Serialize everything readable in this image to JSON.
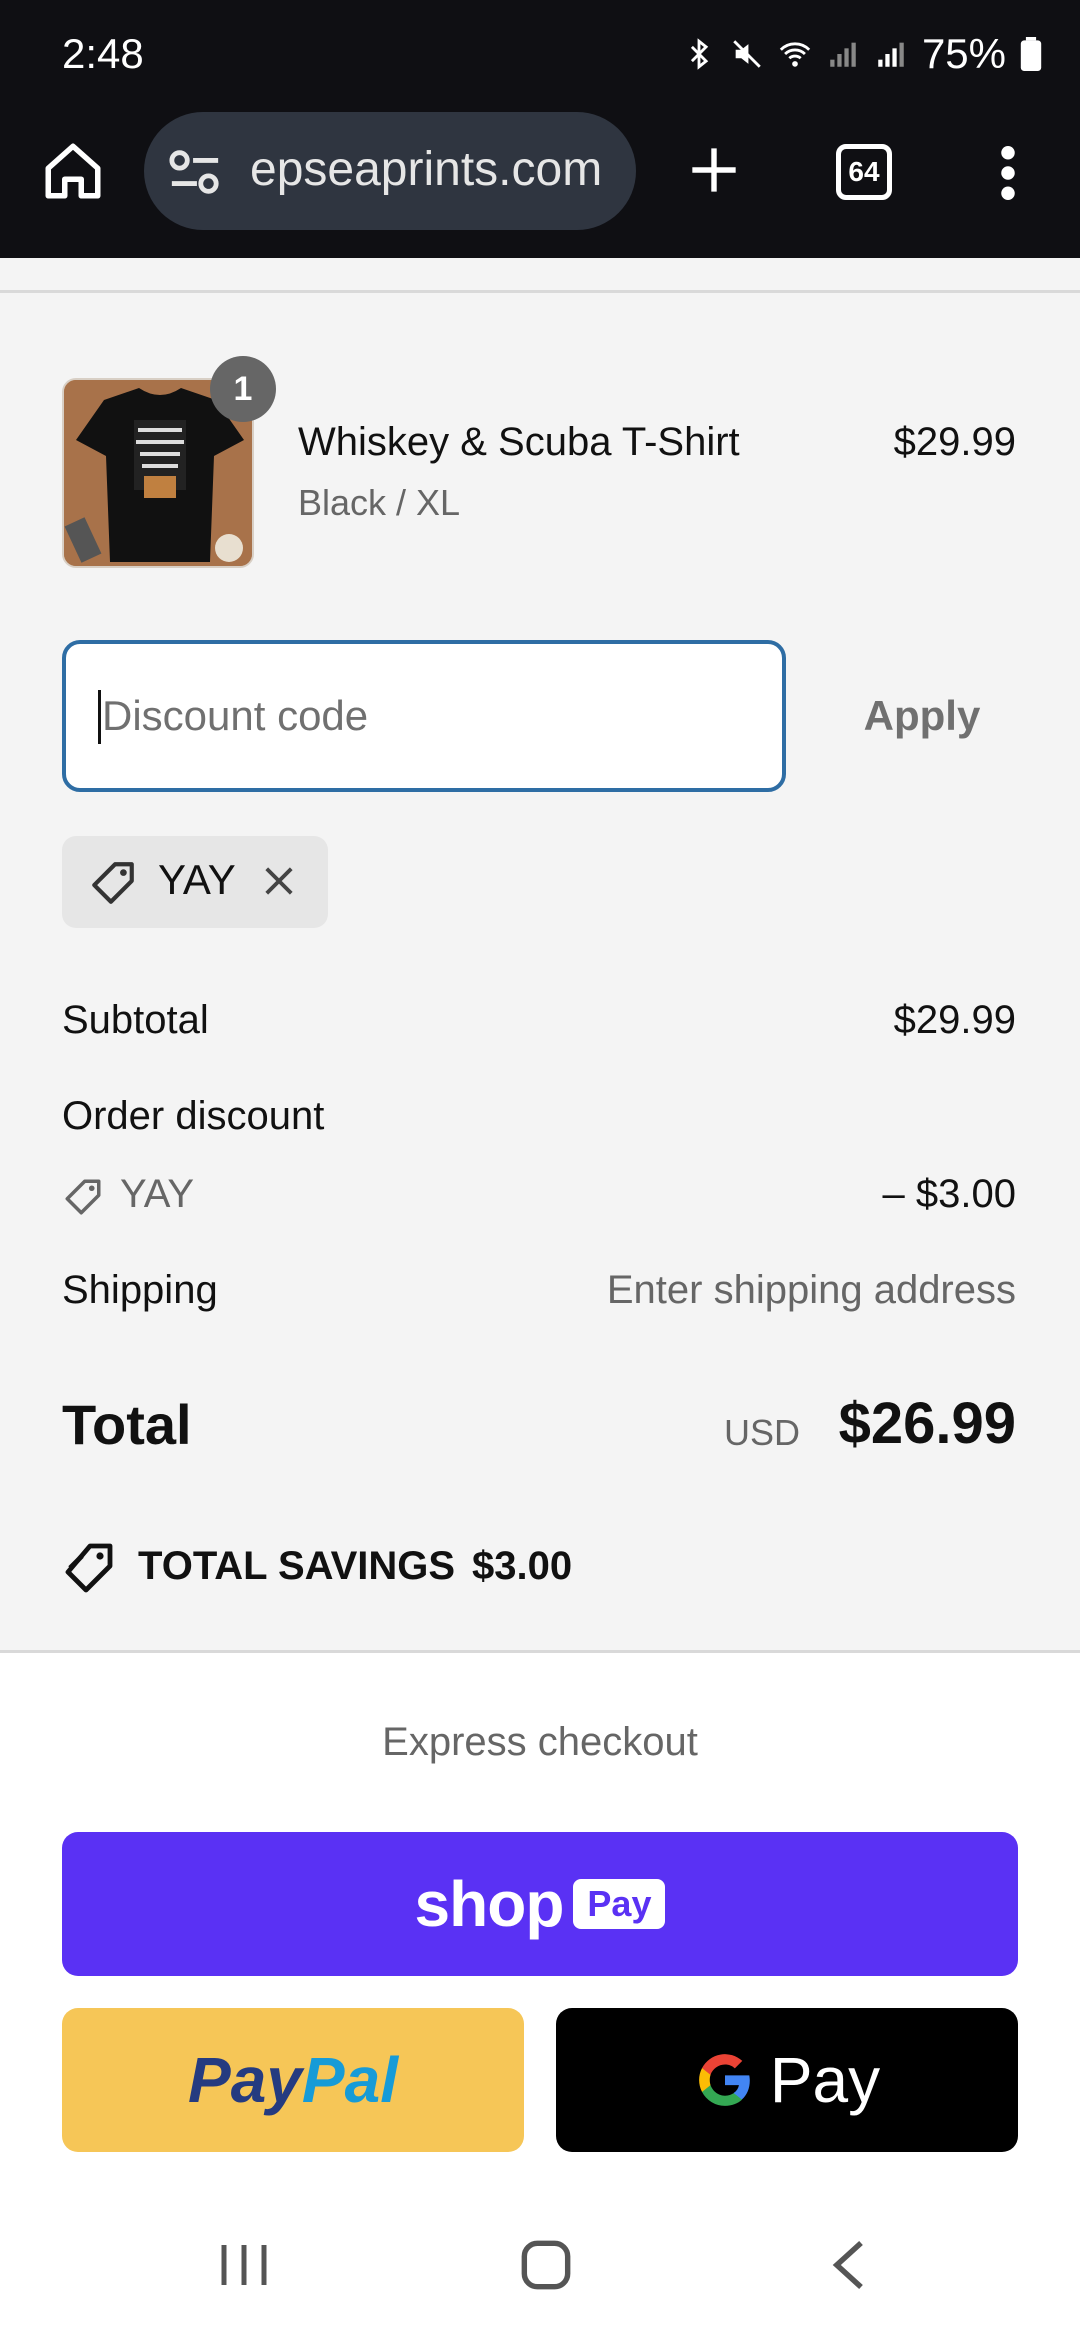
{
  "status_bar": {
    "time": "2:48",
    "battery": "75%"
  },
  "browser": {
    "url": "epseaprints.com",
    "tab_count": "64"
  },
  "product": {
    "quantity": "1",
    "name": "Whiskey & Scuba T-Shirt",
    "variant": "Black / XL",
    "price": "$29.99"
  },
  "discount": {
    "placeholder": "Discount code",
    "apply_label": "Apply",
    "applied_code": "YAY"
  },
  "summary": {
    "subtotal_label": "Subtotal",
    "subtotal_value": "$29.99",
    "order_discount_label": "Order discount",
    "discount_code": "YAY",
    "discount_value": "– $3.00",
    "shipping_label": "Shipping",
    "shipping_value": "Enter shipping address",
    "total_label": "Total",
    "total_currency": "USD",
    "total_value": "$26.99",
    "savings_label": "TOTAL SAVINGS",
    "savings_value": "$3.00"
  },
  "express": {
    "title": "Express checkout",
    "shoppay_word": "shop",
    "shoppay_badge": "Pay",
    "paypal_a": "Pay",
    "paypal_b": "Pal",
    "gpay_label": "Pay"
  },
  "colors": {
    "shoppay": "#5a31f4",
    "paypal": "#f6c657",
    "focus_border": "#2e6da4"
  },
  "icons": [
    "home-icon",
    "tune-icon",
    "plus-icon",
    "tabs-icon",
    "menu-icon",
    "tag-icon",
    "close-icon",
    "savings-tag-icon",
    "google-g-icon"
  ]
}
